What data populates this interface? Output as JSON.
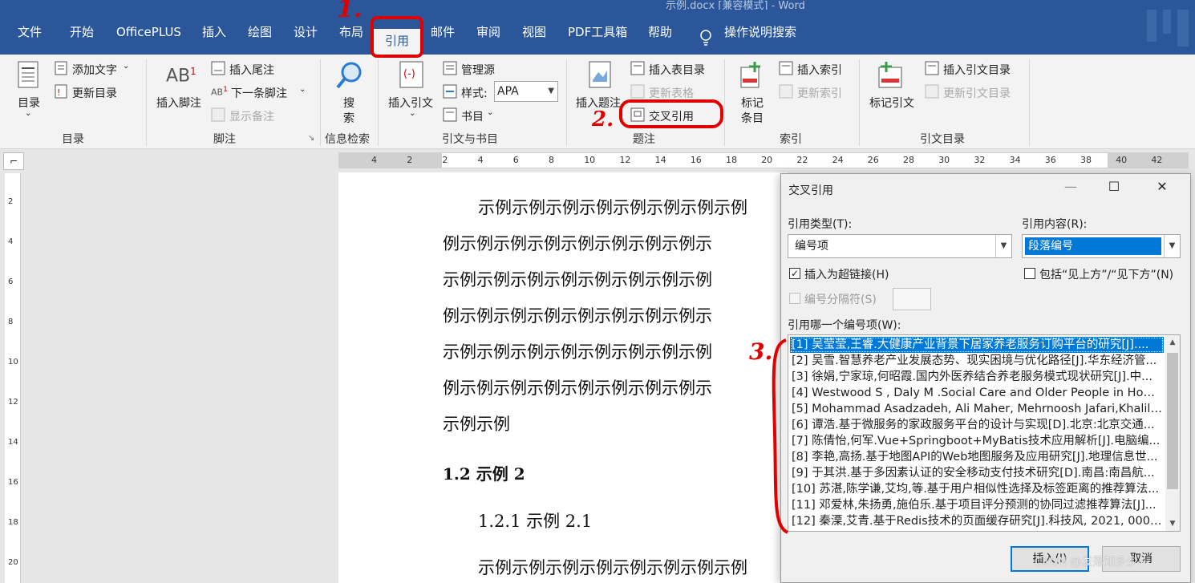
{
  "window": {
    "title_fragment": "示例.docx [兼容模式] - Word"
  },
  "tabs": [
    "文件",
    "开始",
    "OfficePLUS",
    "插入",
    "绘图",
    "设计",
    "布局",
    "引用",
    "邮件",
    "审阅",
    "视图",
    "PDF工具箱",
    "帮助"
  ],
  "active_tab": "引用",
  "tell_me": "操作说明搜索",
  "ribbon": {
    "toc": {
      "big": "目录",
      "add_text": "添加文字",
      "update": "更新目录",
      "label": "目录"
    },
    "footnotes": {
      "insert_footnote": "插入脚注",
      "insert_endnote": "插入尾注",
      "next_footnote": "下一条脚注",
      "show_notes": "显示备注",
      "label": "脚注"
    },
    "research": {
      "search_line1": "搜",
      "search_line2": "索",
      "label": "信息检索"
    },
    "citations": {
      "insert_citation": "插入引文",
      "manage_sources": "管理源",
      "style_label": "样式:",
      "style_value": "APA",
      "bibliography": "书目",
      "label": "引文与书目"
    },
    "captions": {
      "insert_caption": "插入题注",
      "insert_table_of_figures": "插入表目录",
      "update_table": "更新表格",
      "cross_reference": "交叉引用",
      "label": "题注"
    },
    "index": {
      "mark_line1": "标记",
      "mark_line2": "条目",
      "insert_index": "插入索引",
      "update_index": "更新索引",
      "label": "索引"
    },
    "authorities": {
      "mark_citation": "标记引文",
      "insert_table": "插入引文目录",
      "update_table": "更新引文目录",
      "label": "引文目录"
    }
  },
  "ruler": {
    "numbers": [
      "4",
      "2",
      "2",
      "4",
      "6",
      "8",
      "10",
      "12",
      "14",
      "16",
      "18",
      "20",
      "22",
      "24",
      "26",
      "28",
      "30",
      "32",
      "34",
      "36",
      "38",
      "40",
      "42"
    ]
  },
  "vruler": {
    "numbers": [
      "2",
      "4",
      "6",
      "8",
      "10",
      "12",
      "14",
      "16",
      "18",
      "20"
    ]
  },
  "document": {
    "lines": [
      "示例示例示例示例示例示例示例示例",
      "例示例示例示例示例示例示例示例示",
      "示例示例示例示例示例示例示例示例",
      "例示例示例示例示例示例示例示例示",
      "示例示例示例示例示例示例示例示例",
      "例示例示例示例示例示例示例示例示",
      "示例示例"
    ],
    "heading": "1.2 示例 2",
    "subheading": "1.2.1 示例 2.1",
    "last_line": "示例示例示例示例示例示例示例示例"
  },
  "dialog": {
    "title": "交叉引用",
    "ref_type_label": "引用类型(T):",
    "ref_type_value": "编号项",
    "ref_content_label": "引用内容(R):",
    "ref_content_value": "段落编号",
    "hyperlink_label": "插入为超链接(H)",
    "hyperlink_checked": true,
    "include_label": "包括“见上方”/“见下方”(N)",
    "include_checked": false,
    "separator_label": "编号分隔符(S)",
    "which_label": "引用哪一个编号项(W):",
    "items": [
      "[1] 吴莹莹,王睿.大健康产业背景下居家养老服务订购平台的研究[J]....",
      "[2] 吴雪.智慧养老产业发展态势、现实困境与优化路径[J].华东经济管...",
      "[3] 徐娟,宁家琼,何昭霞.国内外医养结合养老服务模式现状研究[J].中...",
      "[4] Westwood S , Daly M .Social Care and Older People in Hom...",
      "[5] Mohammad Asadzadeh, Ali Maher, Mehrnoosh Jafari,Khalil ...",
      "[6] 谭浩.基于微服务的家政服务平台的设计与实现[D].北京:北京交通...",
      "[7] 陈倩怡,何军.Vue+Springboot+MyBatis技术应用解析[J].电脑编...",
      "[8] 李艳,高扬.基于地图API的Web地图服务及应用研究[J].地理信息世...",
      "[9] 于其洪.基于多因素认证的安全移动支付技术研究[D].南昌:南昌航...",
      "[10] 苏湛,陈学谦,艾均,等.基于用户相似性选择及标签距离的推荐算法...",
      "[11] 邓爱林,朱扬勇,施伯乐.基于项目评分预测的协同过滤推荐算法[J]...",
      "[12] 秦溧,艾青.基于Redis技术的页面缓存研究[J].科技风, 2021, 000(..."
    ],
    "selected_index": 0,
    "insert_button": "插入(I)",
    "cancel_button": "取消"
  },
  "annotations": [
    "1.",
    "2.",
    "3."
  ],
  "watermark": "CSDN @发落知多少~",
  "colors": {
    "word_blue": "#2b579a",
    "selection": "#0078d7",
    "annotation_red": "#e00000"
  }
}
